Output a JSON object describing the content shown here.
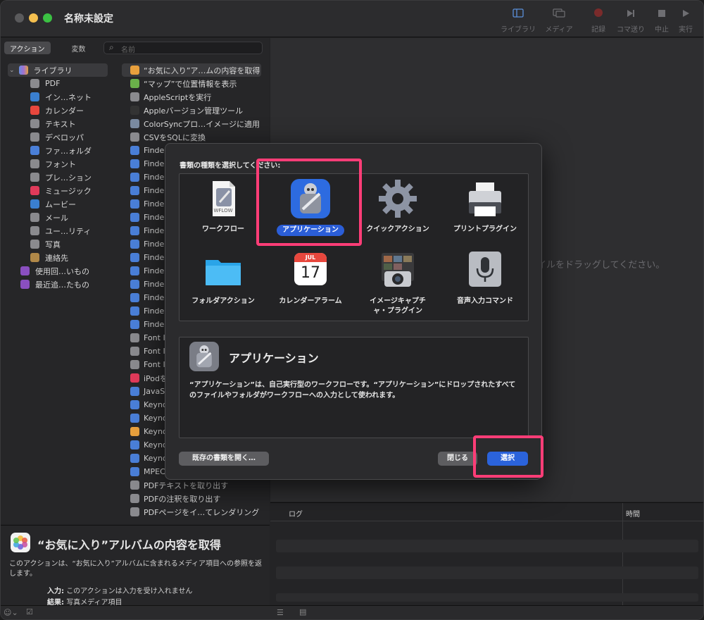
{
  "window": {
    "title": "名称未設定"
  },
  "toolbar": [
    {
      "label": "ライブラリ",
      "icon": "sidebar-icon"
    },
    {
      "label": "メディア",
      "icon": "media-icon"
    },
    {
      "label": "記録",
      "icon": "record-icon"
    },
    {
      "label": "コマ送り",
      "icon": "step-icon"
    },
    {
      "label": "中止",
      "icon": "stop-icon"
    },
    {
      "label": "実行",
      "icon": "run-icon"
    }
  ],
  "left": {
    "tab_actions": "アクション",
    "tab_variables": "変数",
    "search_placeholder": "名前",
    "library_root": "ライブラリ",
    "library_items": [
      "PDF",
      "イン…ネット",
      "カレンダー",
      "テキスト",
      "デベロッパ",
      "ファ…ォルダ",
      "フォント",
      "プレ…ション",
      "ミュージック",
      "ムービー",
      "メール",
      "ユー…リティ",
      "写真",
      "連絡先",
      "使用回…いもの",
      "最近追…たもの"
    ],
    "actions": [
      "“お気に入り”ア…ムの内容を取得",
      "“マップ”で位置情報を表示",
      "AppleScriptを実行",
      "Appleバージョン管理ツール",
      "ColorSyncプロ…イメージに適用",
      "CSVをSQLに変換",
      "Finde",
      "Finde",
      "Finde",
      "Finde",
      "Finde",
      "Finde",
      "Finde",
      "Finde",
      "Finde",
      "Finde",
      "Finde",
      "Finde",
      "Finde",
      "Finde",
      "Font I",
      "Font I",
      "Font I",
      "iPodを",
      "JavaS",
      "Keyno",
      "Keyno",
      "Keyno",
      "Keyno",
      "Keyno",
      "MPEC",
      "PDFテキストを取り出す",
      "PDFの注釈を取り出す",
      "PDFページをイ…てレンダリング"
    ]
  },
  "info": {
    "title": "“お気に入り”アルバムの内容を取得",
    "description": "このアクションは、“お気に入り”アルバムに含まれるメディア項目への参照を返します。",
    "input_label": "入力:",
    "input_value": "このアクションは入力を受け入れません",
    "result_label": "結果:",
    "result_value": "写真メディア項目"
  },
  "workflow": {
    "drop_hint": "イルをドラッグしてください。"
  },
  "log": {
    "col_log": "ログ",
    "col_time": "時間"
  },
  "dialog": {
    "heading": "書類の種類を選択してください:",
    "types": [
      {
        "label": "ワークフロー",
        "icon": "workflow-document-icon",
        "badge": "WFLOW"
      },
      {
        "label": "アプリケーション",
        "icon": "automator-robot-icon",
        "selected": true
      },
      {
        "label": "クイックアクション",
        "icon": "gear-icon"
      },
      {
        "label": "プリントプラグイン",
        "icon": "printer-icon"
      },
      {
        "label": "フォルダアクション",
        "icon": "folder-icon"
      },
      {
        "label": "カレンダーアラーム",
        "icon": "calendar-icon",
        "month": "JUL",
        "day": "17"
      },
      {
        "label": "イメージキャプチャ・プラグイン",
        "line1": "イメージキャプチ",
        "line2": "ャ・プラグイン",
        "icon": "camera-icon"
      },
      {
        "label": "音声入力コマンド",
        "icon": "microphone-icon"
      }
    ],
    "description_title": "アプリケーション",
    "description_text": "“アプリケーション”は、自己実行型のワークフローです。“アプリケーション”にドロップされたすべてのファイルやフォルダがワークフローへの入力として使われます。",
    "open_existing": "既存の書類を開く…",
    "close": "閉じる",
    "choose": "選択"
  },
  "colors": {
    "accent": "#2b63db",
    "highlight": "#ff3d77"
  }
}
